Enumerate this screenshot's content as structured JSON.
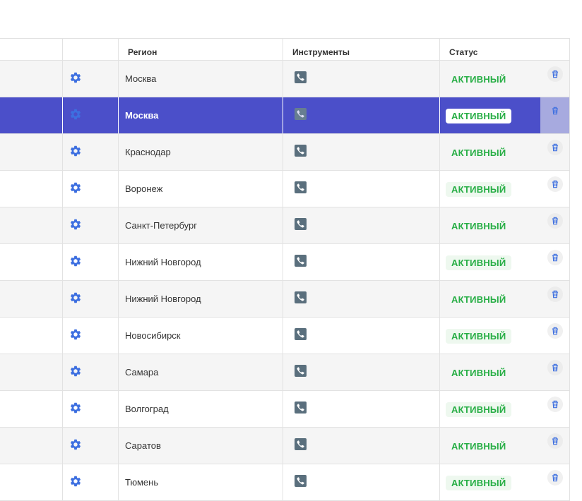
{
  "table": {
    "headers": {
      "blank1": "",
      "blank2": "",
      "region": "Регион",
      "tools": "Инструменты",
      "status": "Статус"
    },
    "rows": [
      {
        "region": "Москва",
        "status": "АКТИВНЫЙ"
      },
      {
        "region": "Москва",
        "status": "АКТИВНЫЙ",
        "selected": true
      },
      {
        "region": "Краснодар",
        "status": "АКТИВНЫЙ"
      },
      {
        "region": "Воронеж",
        "status": "АКТИВНЫЙ"
      },
      {
        "region": "Санкт-Петербург",
        "status": "АКТИВНЫЙ"
      },
      {
        "region": "Нижний Новгород",
        "status": "АКТИВНЫЙ"
      },
      {
        "region": "Нижний Новгород",
        "status": "АКТИВНЫЙ"
      },
      {
        "region": "Новосибирск",
        "status": "АКТИВНЫЙ"
      },
      {
        "region": "Самара",
        "status": "АКТИВНЫЙ"
      },
      {
        "region": "Волгоград",
        "status": "АКТИВНЫЙ"
      },
      {
        "region": "Саратов",
        "status": "АКТИВНЫЙ"
      },
      {
        "region": "Тюмень",
        "status": "АКТИВНЫЙ"
      }
    ],
    "icons": {
      "settings": "gear-icon",
      "tool": "phone-icon",
      "delete": "trash-icon"
    },
    "colors": {
      "accent": "#4b4fc9",
      "status_green": "#27ae45",
      "icon_blue": "#3d6fe0"
    }
  }
}
